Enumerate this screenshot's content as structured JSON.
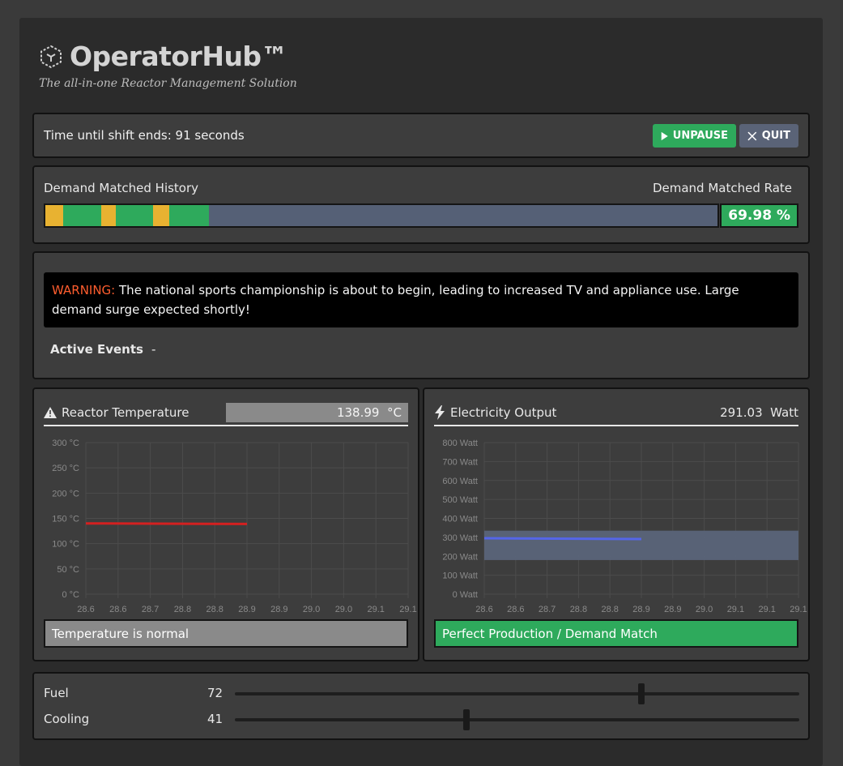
{
  "app": {
    "title": "OperatorHub™",
    "tagline": "The all-in-one Reactor Management Solution"
  },
  "timer": {
    "text": "Time until shift ends: 91 seconds",
    "unpause_label": "UNPAUSE",
    "quit_label": "QUIT"
  },
  "history": {
    "title": "Demand Matched History",
    "rate_title": "Demand Matched Rate",
    "rate_value": "69.98 %",
    "segments": [
      {
        "status": "warn",
        "color": "#e8b231"
      },
      {
        "status": "ok",
        "color": "#2eaa5c"
      },
      {
        "status": "warn",
        "color": "#e8b231"
      },
      {
        "status": "ok",
        "color": "#2eaa5c"
      },
      {
        "status": "warn",
        "color": "#e8b231"
      },
      {
        "status": "ok",
        "color": "#2eaa5c"
      }
    ]
  },
  "events": {
    "warning_label": "WARNING:",
    "warning_text": " The national sports championship is about to begin, leading to increased TV and appliance use. Large demand surge expected shortly!",
    "active_label": "Active Events",
    "active_value": "-"
  },
  "temperature": {
    "title": "Reactor Temperature",
    "value": "138.99",
    "unit": "°C",
    "status": "Temperature is normal",
    "line_color": "#d42020"
  },
  "electricity": {
    "title": "Electricity Output",
    "value": "291.03",
    "unit": "Watt",
    "status": "Perfect Production / Demand Match",
    "line_color": "#5566e8",
    "band_color": "#5a6479"
  },
  "controls": {
    "fuel_label": "Fuel",
    "fuel_value": "72",
    "fuel_fraction": 0.72,
    "cooling_label": "Cooling",
    "cooling_value": "41",
    "cooling_fraction": 0.41
  },
  "chart_data": [
    {
      "type": "line",
      "title": "Reactor Temperature",
      "xlabel": "",
      "ylabel": "",
      "ylim": [
        0,
        300
      ],
      "yticks": [
        "0 °C",
        "50 °C",
        "100 °C",
        "150 °C",
        "200 °C",
        "250 °C",
        "300 °C"
      ],
      "xticks": [
        "28.6",
        "28.6",
        "28.7",
        "28.8",
        "28.8",
        "28.9",
        "28.9",
        "29.0",
        "29.0",
        "29.1",
        "29.1"
      ],
      "xlim": [
        28.6,
        29.1
      ],
      "grid": true,
      "series": [
        {
          "x": [
            28.6,
            28.85
          ],
          "y": [
            140,
            138.99
          ],
          "color": "#d42020"
        }
      ]
    },
    {
      "type": "line",
      "title": "Electricity Output",
      "xlabel": "",
      "ylabel": "",
      "ylim": [
        0,
        800
      ],
      "yticks": [
        "0 Watt",
        "100 Watt",
        "200 Watt",
        "300 Watt",
        "400 Watt",
        "500 Watt",
        "600 Watt",
        "700 Watt",
        "800 Watt"
      ],
      "xticks": [
        "28.6",
        "28.6",
        "28.7",
        "28.8",
        "28.8",
        "28.9",
        "28.9",
        "29.0",
        "29.1",
        "29.1",
        "29.1"
      ],
      "xlim": [
        28.6,
        29.1
      ],
      "grid": true,
      "band": {
        "from": 180,
        "to": 335
      },
      "series": [
        {
          "x": [
            28.6,
            28.85
          ],
          "y": [
            295,
            291.03
          ],
          "color": "#5566e8"
        }
      ]
    }
  ]
}
